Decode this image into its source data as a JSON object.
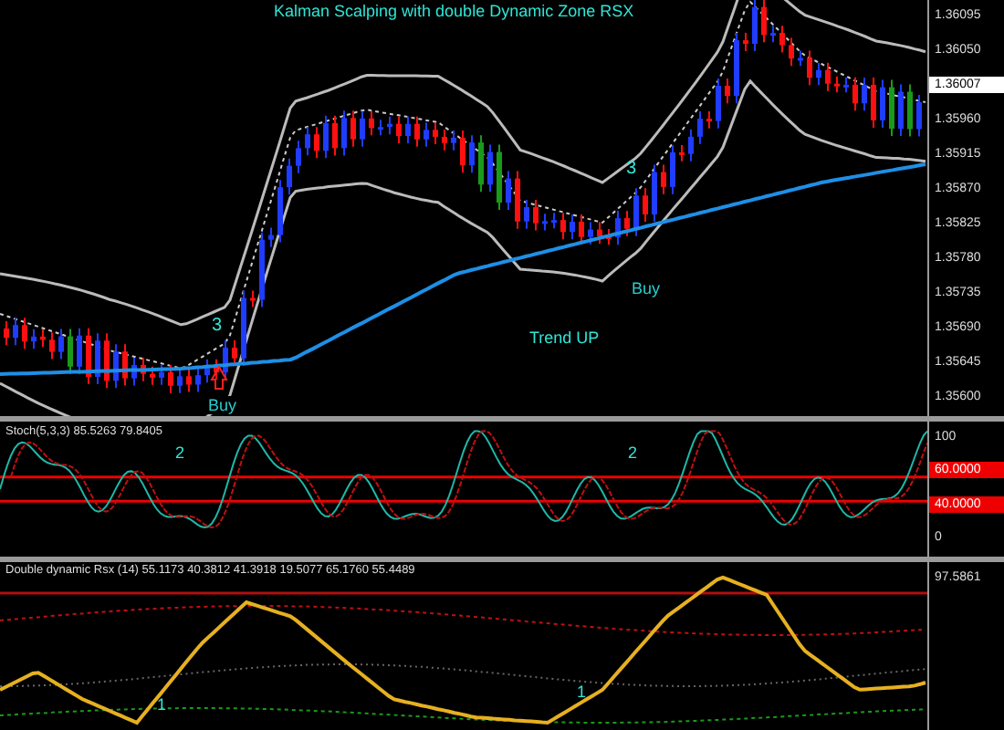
{
  "chart_title": "Kalman Scalping with double Dynamic Zone RSX",
  "main_pane": {
    "price_axis": [
      {
        "text": "1.36095",
        "kind": "tick"
      },
      {
        "text": "1.36050",
        "kind": "tick"
      },
      {
        "text": "1.36007",
        "kind": "current"
      },
      {
        "text": "1.35960",
        "kind": "tick"
      },
      {
        "text": "1.35915",
        "kind": "tick"
      },
      {
        "text": "1.35870",
        "kind": "tick"
      },
      {
        "text": "1.35825",
        "kind": "tick"
      },
      {
        "text": "1.35780",
        "kind": "tick"
      },
      {
        "text": "1.35735",
        "kind": "tick"
      },
      {
        "text": "1.35690",
        "kind": "tick"
      },
      {
        "text": "1.35645",
        "kind": "tick"
      },
      {
        "text": "1.35600",
        "kind": "tick"
      }
    ],
    "signals": [
      {
        "text": "3",
        "kind": "count"
      },
      {
        "text": "Buy",
        "kind": "buy"
      },
      {
        "text": "Trend UP",
        "kind": "trend"
      },
      {
        "text": "3",
        "kind": "count"
      },
      {
        "text": "Buy",
        "kind": "buy"
      }
    ]
  },
  "stochastic_pane": {
    "header": "Stoch(5,3,3) 85.5263 79.8405",
    "axis": [
      {
        "text": "100",
        "kind": "tick"
      },
      {
        "text": "60.0000",
        "kind": "level"
      },
      {
        "text": "40.0000",
        "kind": "level"
      },
      {
        "text": "0",
        "kind": "tick"
      }
    ],
    "signals": [
      {
        "text": "2"
      },
      {
        "text": "2"
      }
    ]
  },
  "rsx_pane": {
    "header": "Double dynamic Rsx (14) 55.1173 40.3812 41.3918 19.5077 65.1760 55.4489",
    "axis": [
      {
        "text": "97.5861",
        "kind": "tick"
      }
    ],
    "signals": [
      {
        "text": "1"
      },
      {
        "text": "1"
      }
    ]
  }
}
